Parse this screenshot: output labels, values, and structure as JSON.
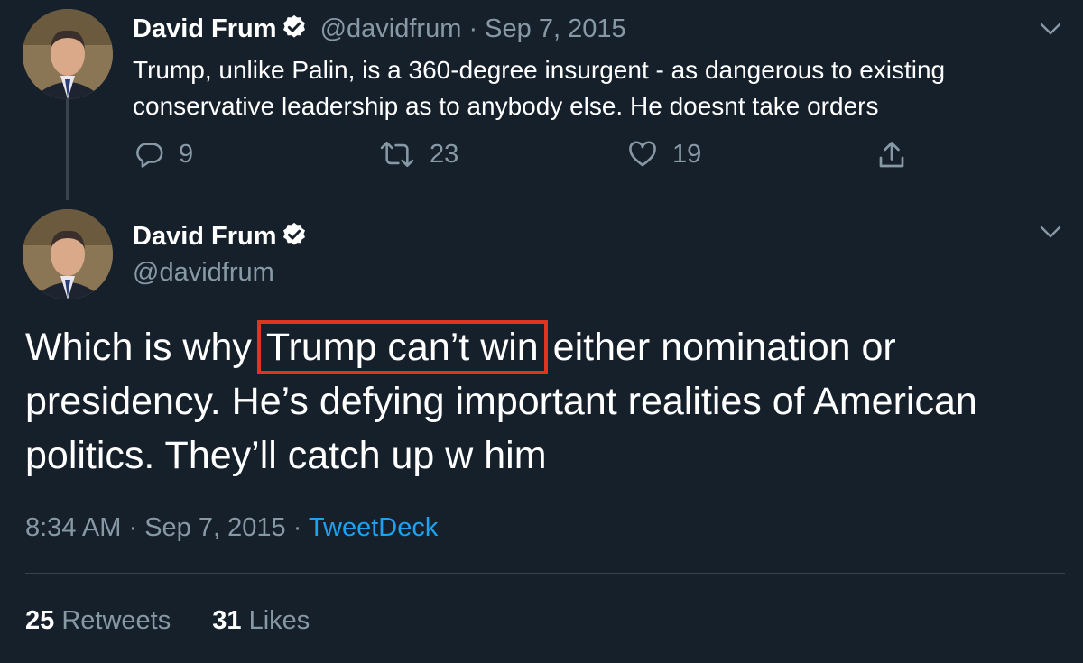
{
  "parent_tweet": {
    "author_name": "David Frum",
    "handle": "@davidfrum",
    "separator": "·",
    "date": "Sep 7, 2015",
    "text": "Trump, unlike Palin, is a 360-degree insurgent - as dangerous to existing conservative leadership as to anybody else. He doesnt take orders",
    "replies": "9",
    "retweets": "23",
    "likes": "19"
  },
  "main_tweet": {
    "author_name": "David Frum",
    "handle": "@davidfrum",
    "text_before": "Which is why ",
    "text_highlight": "Trump can’t win",
    "text_after": " either nomination or presidency. He’s defying important realities of American politics. They’ll catch up w him",
    "time": "8:34 AM",
    "separator": "·",
    "date": "Sep 7, 2015",
    "source": "TweetDeck",
    "retweet_count": "25",
    "retweet_label": "Retweets",
    "like_count": "31",
    "like_label": "Likes"
  },
  "colors": {
    "background": "#15202b",
    "secondary_text": "#8899a6",
    "link": "#1da1f2",
    "highlight_box": "#e0341f",
    "divider": "#38444d"
  },
  "icons": [
    "verified-badge-icon",
    "chevron-down-icon",
    "reply-icon",
    "retweet-icon",
    "like-icon",
    "share-icon"
  ]
}
